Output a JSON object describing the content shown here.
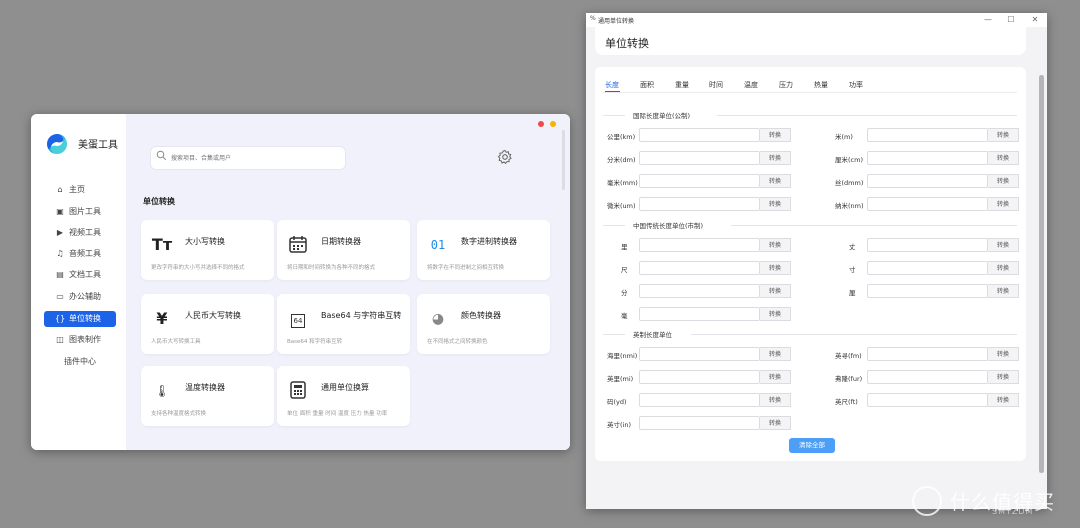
{
  "app": {
    "name": "美蛋工具",
    "nav": [
      {
        "label": "主页",
        "icon": "home-icon",
        "glyph": "⌂"
      },
      {
        "label": "图片工具",
        "icon": "image-icon",
        "glyph": "▣"
      },
      {
        "label": "视频工具",
        "icon": "video-icon",
        "glyph": "▶"
      },
      {
        "label": "音频工具",
        "icon": "headphones-icon",
        "glyph": "♫"
      },
      {
        "label": "文档工具",
        "icon": "document-icon",
        "glyph": "▤"
      },
      {
        "label": "办公辅助",
        "icon": "folder-icon",
        "glyph": "▭"
      },
      {
        "label": "单位转换",
        "icon": "braces-icon",
        "glyph": "{}"
      },
      {
        "label": "图表制作",
        "icon": "chart-icon",
        "glyph": "◫"
      },
      {
        "label": "插件中心",
        "icon": "",
        "glyph": ""
      }
    ],
    "search_placeholder": "搜索项目、合集或用户",
    "section_title": "单位转换",
    "cards": [
      {
        "title": "大小写转换",
        "desc": "更改字符串的大小写并选择不同的格式",
        "icon": "text-case-icon",
        "glyph": "Tт"
      },
      {
        "title": "日期转换器",
        "desc": "将日期和时间转换为各种不同的格式",
        "icon": "calendar-icon",
        "glyph": ""
      },
      {
        "title": "数字进制转换器",
        "desc": "将数字在不同进制之间相互转换",
        "icon": "binary-icon",
        "glyph": "01"
      },
      {
        "title": "人民币大写转换",
        "desc": "人民币大写转换工具",
        "icon": "yuan-icon",
        "glyph": "¥"
      },
      {
        "title": "Base64 与字符串互转",
        "desc": "Base64 和字符串互转",
        "icon": "base64-icon",
        "glyph": "64"
      },
      {
        "title": "颜色转换器",
        "desc": "在不同格式之间转换颜色",
        "icon": "palette-icon",
        "glyph": "◕"
      },
      {
        "title": "温度转换器",
        "desc": "支持各种温度格式转换",
        "icon": "thermometer-icon",
        "glyph": "🌡"
      },
      {
        "title": "通用单位换算",
        "desc": "单位 面积 重量 时间 温度 压力 热量 功率",
        "icon": "calculator-icon",
        "glyph": ""
      }
    ],
    "colors": {
      "accent": "#1d63e8",
      "close": "#f04a4a",
      "minimize": "#f5b400",
      "main_bg": "#f1f1fb"
    }
  },
  "converter": {
    "window_title": "通用单位转换",
    "window_icon": "%",
    "header_title": "单位转换",
    "tabs": [
      "长度",
      "面积",
      "重量",
      "时间",
      "温度",
      "压力",
      "热量",
      "功率"
    ],
    "active_tab": "长度",
    "convert_label": "转换",
    "groups": [
      {
        "title": "国际长度单位(公制)",
        "units": [
          "公里(km)",
          "米(m)",
          "分米(dm)",
          "厘米(cm)",
          "毫米(mm)",
          "丝(dmm)",
          "微米(um)",
          "纳米(nm)"
        ]
      },
      {
        "title": "中国传统长度单位(市制)",
        "units": [
          "里",
          "丈",
          "尺",
          "寸",
          "分",
          "厘",
          "毫"
        ]
      },
      {
        "title": "英制长度单位",
        "units": [
          "海里(nmi)",
          "英寻(fm)",
          "英里(mi)",
          "弗隆(fur)",
          "码(yd)",
          "英尺(ft)",
          "英寸(in)"
        ]
      }
    ],
    "clear_label": "清除全部",
    "window_controls": [
      "—",
      "☐",
      "✕"
    ]
  },
  "watermark": {
    "text": "什么值得买",
    "sub": "SMYZDM"
  }
}
